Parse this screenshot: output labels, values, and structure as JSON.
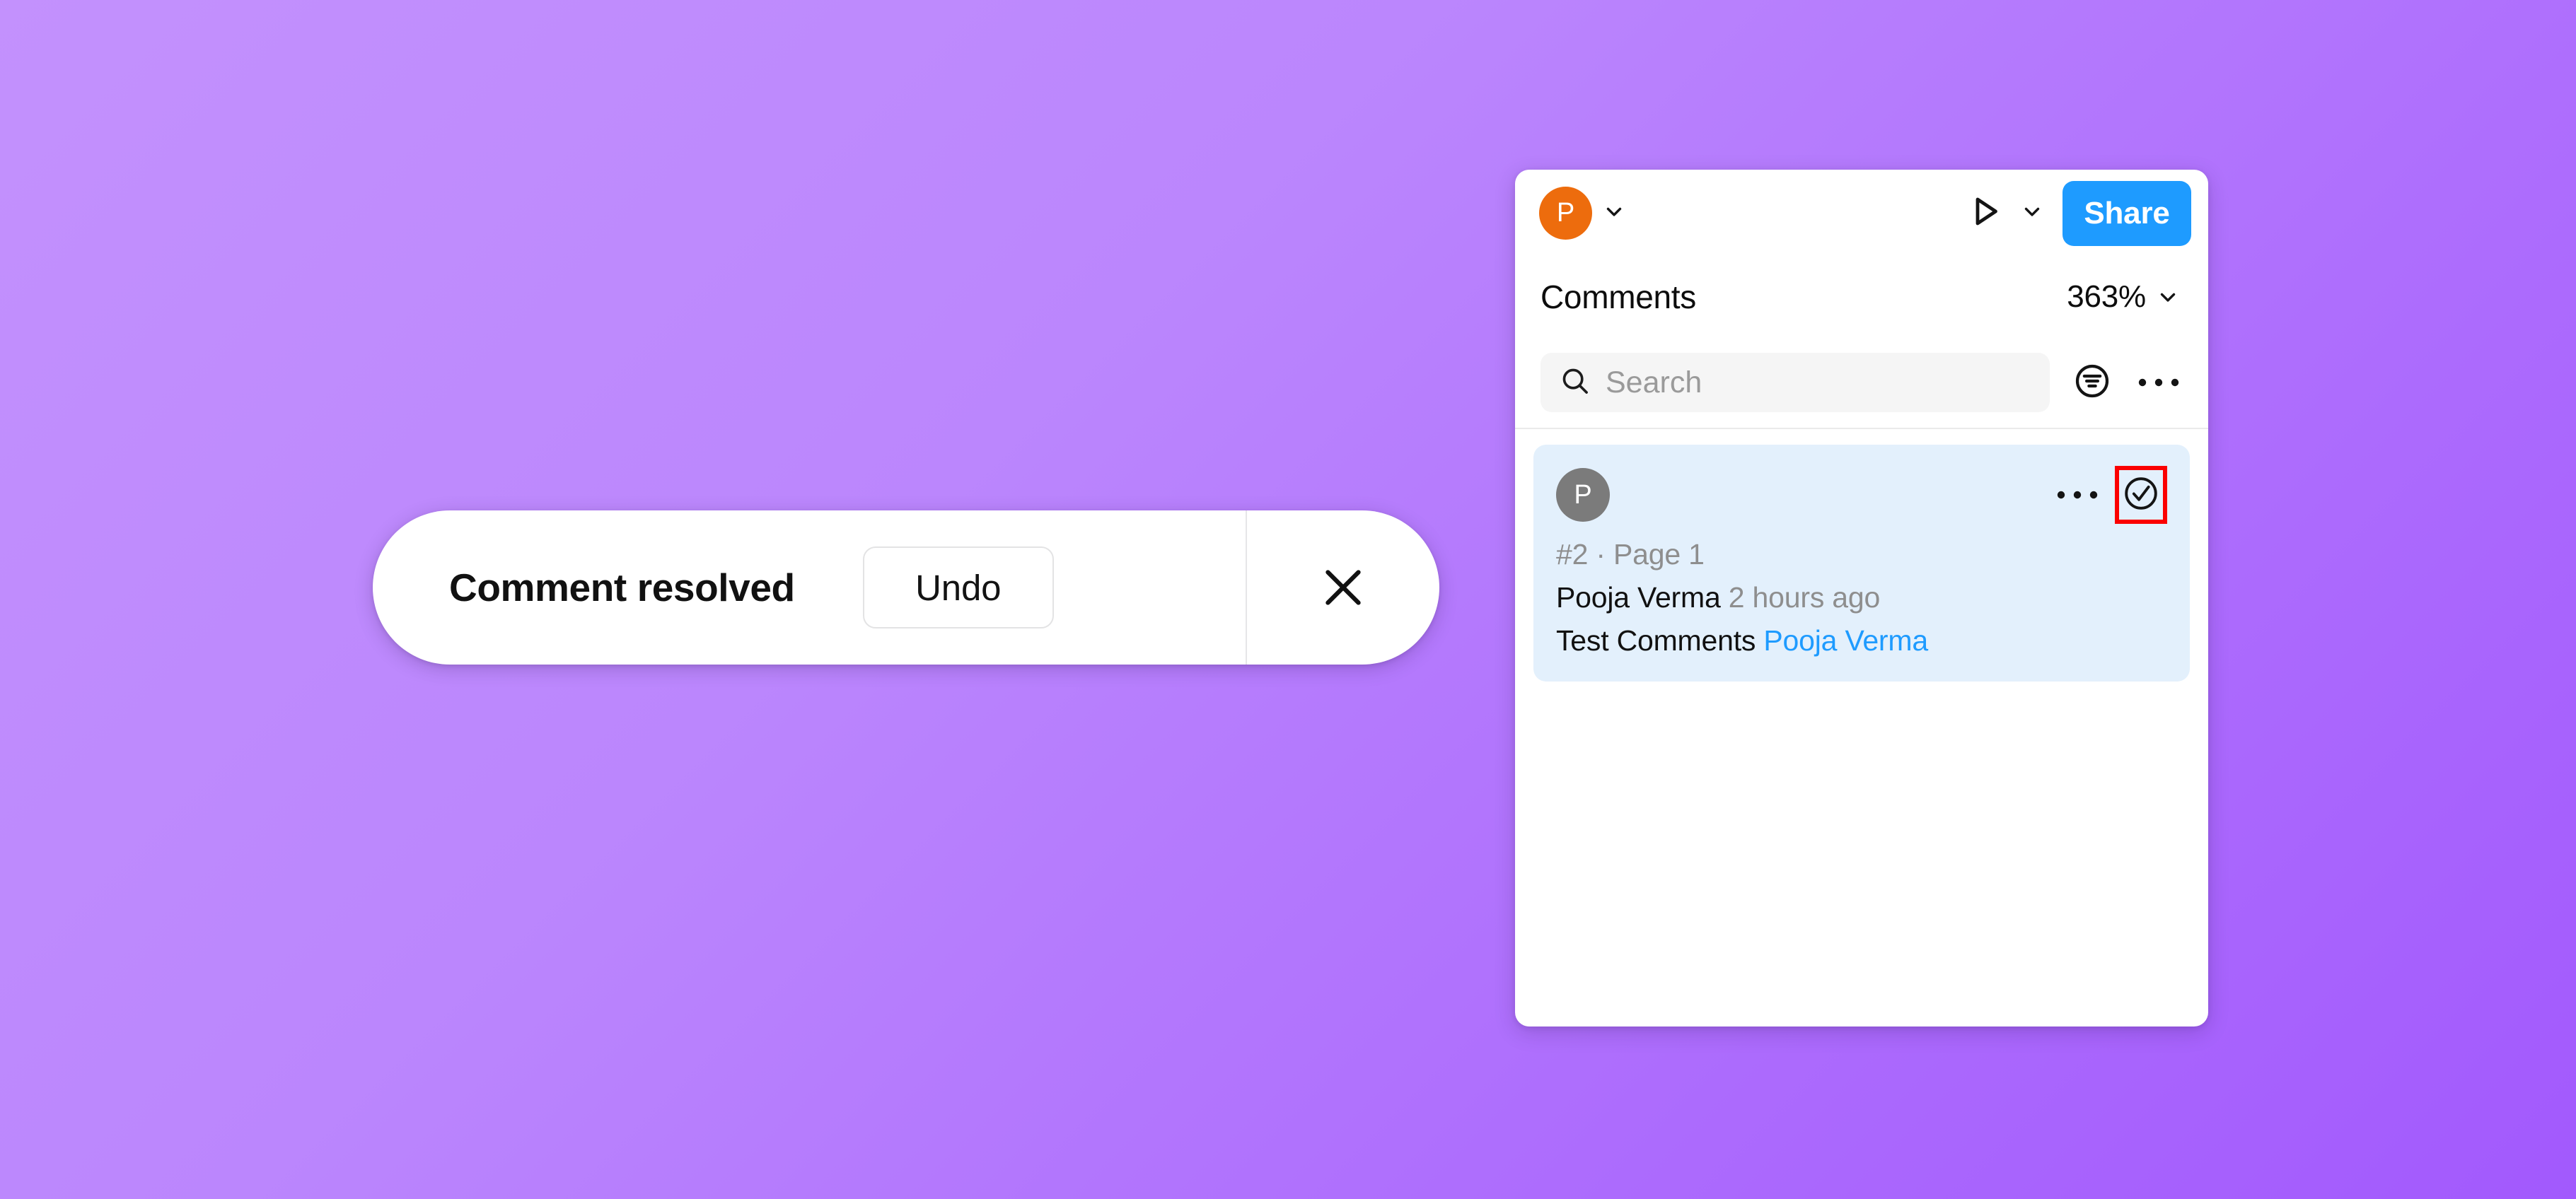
{
  "background": {
    "gradient_from": "#c391fd",
    "gradient_to": "#a259fd"
  },
  "toast": {
    "message": "Comment resolved",
    "undo_label": "Undo",
    "close_icon": "close-x-icon"
  },
  "panel": {
    "topbar": {
      "avatar_initial": "P",
      "avatar_color": "#ed6c0d",
      "avatar_chevron_icon": "chevron-down-icon",
      "present_icon": "play-triangle-icon",
      "present_chevron_icon": "chevron-down-icon",
      "share_label": "Share",
      "share_color": "#1e9bff"
    },
    "header": {
      "title": "Comments",
      "zoom_level": "363%",
      "zoom_chevron_icon": "chevron-down-icon"
    },
    "search": {
      "placeholder": "Search",
      "value": "",
      "search_icon": "search-icon",
      "filter_icon": "filter-sort-icon",
      "more_icon": "more-horizontal-icon"
    },
    "comments": [
      {
        "avatar_initial": "P",
        "avatar_color": "#7b7b7b",
        "more_icon": "more-horizontal-icon",
        "resolve_icon": "check-circle-icon",
        "resolve_highlight_color": "#fb0000",
        "meta": "#2 · Page 1",
        "author": "Pooja Verma",
        "timestamp": "2 hours ago",
        "body_text": "Test Comments ",
        "body_mention": "Pooja Verma",
        "card_color": "#e3f0fc"
      }
    ]
  }
}
